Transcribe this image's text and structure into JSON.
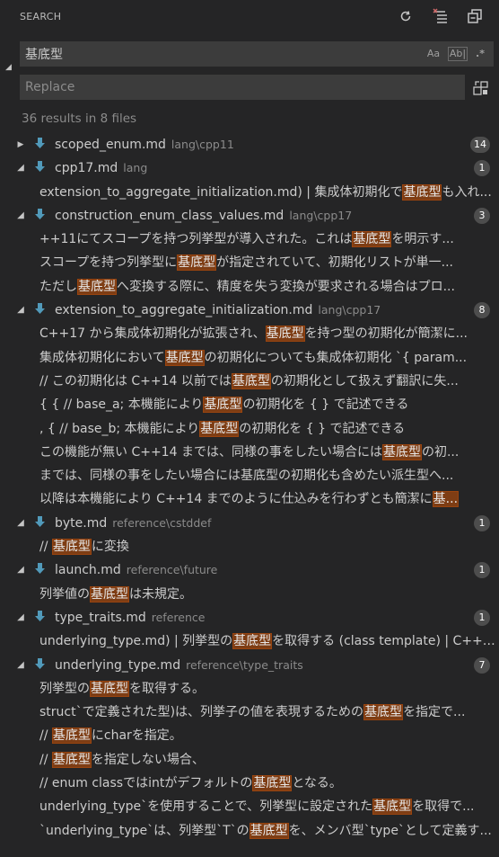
{
  "header": {
    "title": "SEARCH"
  },
  "search": {
    "query": "基底型",
    "match_case_label": "Aa",
    "whole_word_label": "Ab|",
    "regex_label": ".*",
    "replace_placeholder": "Replace"
  },
  "summary": "36 results in 8 files",
  "colors": {
    "highlight": "#ea5c00",
    "badge": "#4d4d4d",
    "file_icon": "#519aba"
  },
  "files": [
    {
      "name": "scoped_enum.md",
      "path": "lang\\cpp11",
      "count": "14",
      "expanded": false,
      "matches": []
    },
    {
      "name": "cpp17.md",
      "path": "lang",
      "count": "1",
      "expanded": true,
      "matches": [
        [
          "extension_to_aggregate_initialization.md) | 集成体初期化で",
          "基底型",
          "も入れ..."
        ]
      ]
    },
    {
      "name": "construction_enum_class_values.md",
      "path": "lang\\cpp17",
      "count": "3",
      "expanded": true,
      "matches": [
        [
          "++11にてスコープを持つ列挙型が導入された。これは",
          "基底型",
          "を明示す..."
        ],
        [
          "スコープを持つ列挙型に",
          "基底型",
          "が指定されていて、初期化リストが単一..."
        ],
        [
          "ただし",
          "基底型",
          "へ変換する際に、精度を失う変換が要求される場合はプロ..."
        ]
      ]
    },
    {
      "name": "extension_to_aggregate_initialization.md",
      "path": "lang\\cpp17",
      "count": "8",
      "expanded": true,
      "matches": [
        [
          "C++17 から集成体初期化が拡張され、",
          "基底型",
          "を持つ型の初期化が簡潔に..."
        ],
        [
          "集成体初期化において",
          "基底型",
          "の初期化についても集成体初期化 `{ param..."
        ],
        [
          "// この初期化は C++14 以前では",
          "基底型",
          "の初期化として扱えず翻訳に失..."
        ],
        [
          "{ { // base_a; 本機能により",
          "基底型",
          "の初期化を { } で記述できる"
        ],
        [
          ", { // base_b; 本機能により",
          "基底型",
          "の初期化を { } で記述できる"
        ],
        [
          "この機能が無い C++14 までは、同様の事をしたい場合には",
          "基底型",
          "の初..."
        ],
        [
          "までは、同様の事をしたい場合には基底型の初期化も含めたい派生型へ...",
          "",
          ""
        ],
        [
          "以降は本機能により C++14 までのように仕込みを行わずとも簡潔に",
          "基...",
          ""
        ]
      ]
    },
    {
      "name": "byte.md",
      "path": "reference\\cstddef",
      "count": "1",
      "expanded": true,
      "matches": [
        [
          "// ",
          "基底型",
          "に変換"
        ]
      ]
    },
    {
      "name": "launch.md",
      "path": "reference\\future",
      "count": "1",
      "expanded": true,
      "matches": [
        [
          "列挙値の",
          "基底型",
          "は未規定。"
        ]
      ]
    },
    {
      "name": "type_traits.md",
      "path": "reference",
      "count": "1",
      "expanded": true,
      "matches": [
        [
          "underlying_type.md) | 列挙型の",
          "基底型",
          "を取得する (class template) | C++1..."
        ]
      ]
    },
    {
      "name": "underlying_type.md",
      "path": "reference\\type_traits",
      "count": "7",
      "expanded": true,
      "matches": [
        [
          "列挙型の",
          "基底型",
          "を取得する。"
        ],
        [
          "struct`で定義された型)は、列挙子の値を表現するための",
          "基底型",
          "を指定で..."
        ],
        [
          "// ",
          "基底型",
          "にcharを指定。"
        ],
        [
          "// ",
          "基底型",
          "を指定しない場合、"
        ],
        [
          "// enum classではintがデフォルトの",
          "基底型",
          "となる。"
        ],
        [
          "underlying_type`を使用することで、列挙型に設定された",
          "基底型",
          "を取得で..."
        ],
        [
          "`underlying_type`は、列挙型`T`の",
          "基底型",
          "を、メンバ型`type`として定義す..."
        ]
      ]
    }
  ]
}
